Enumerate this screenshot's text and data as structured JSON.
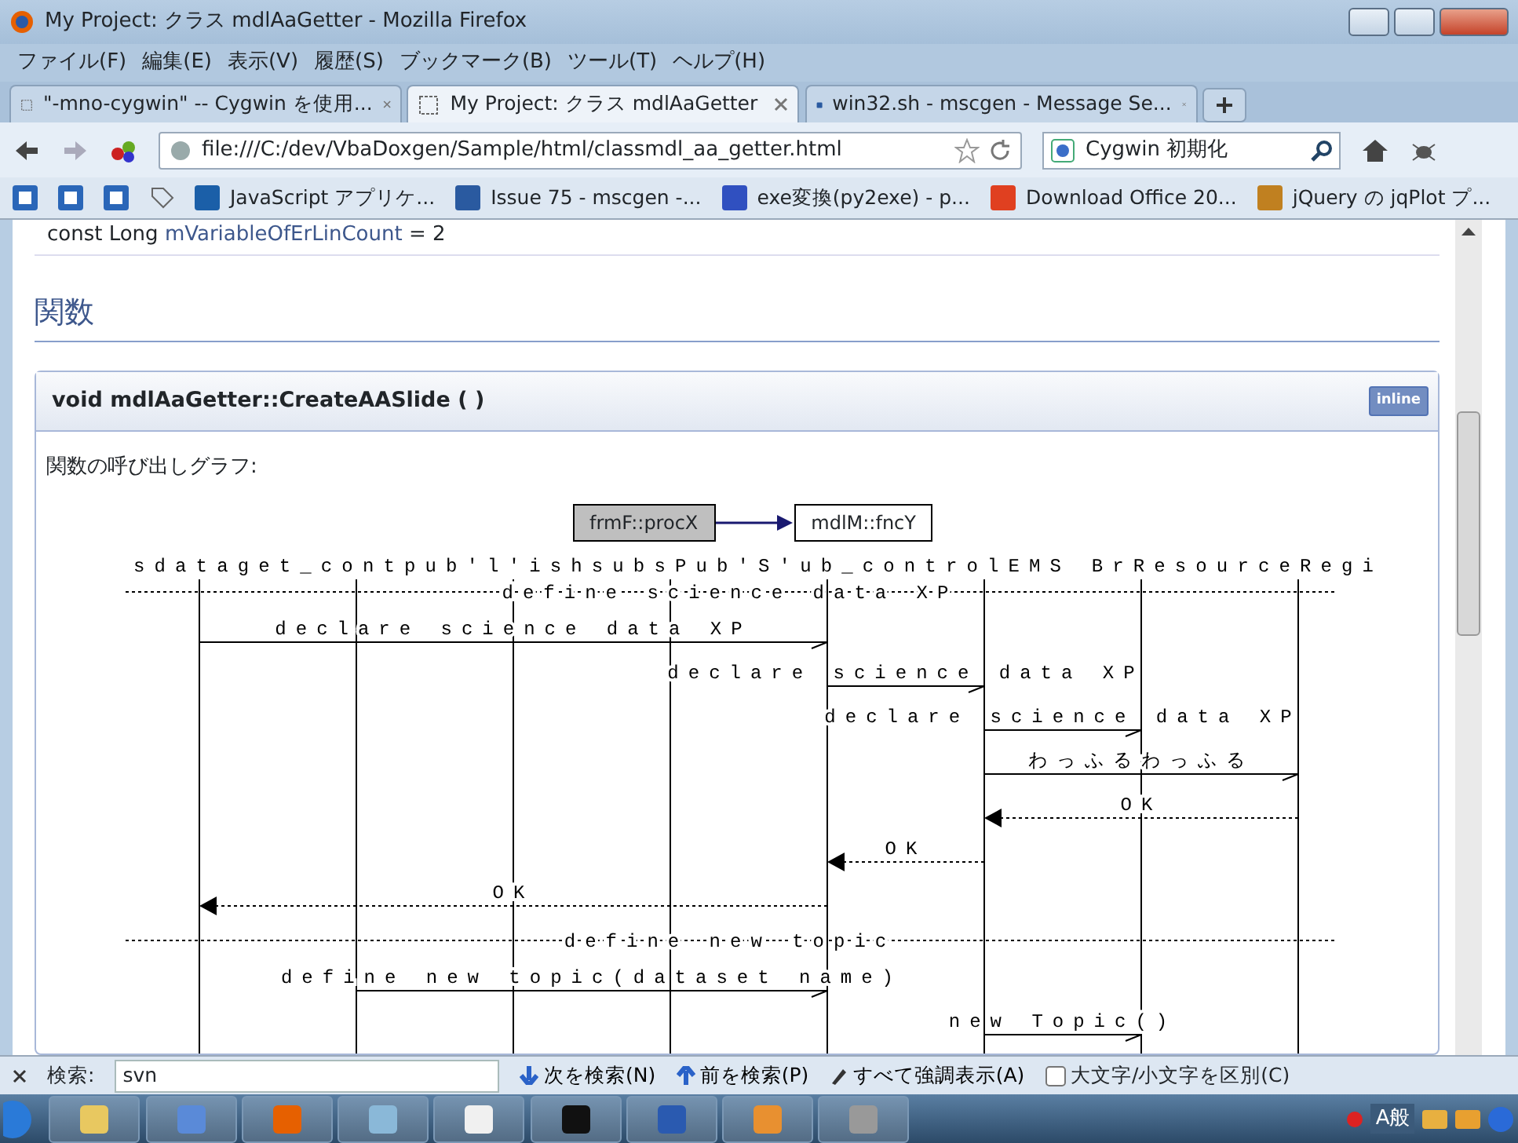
{
  "window": {
    "title": "My Project: クラス mdlAaGetter - Mozilla Firefox"
  },
  "menu": [
    "ファイル(F)",
    "編集(E)",
    "表示(V)",
    "履歴(S)",
    "ブックマーク(B)",
    "ツール(T)",
    "ヘルプ(H)"
  ],
  "tabs": [
    {
      "label": "\"-mno-cygwin\" -- Cygwin を使用...",
      "selected": false
    },
    {
      "label": "My Project: クラス mdlAaGetter",
      "selected": true
    },
    {
      "label": "win32.sh - mscgen - Message Se...",
      "selected": false
    }
  ],
  "address": {
    "url": "file:///C:/dev/VbaDoxgen/Sample/html/classmdl_aa_getter.html"
  },
  "search": {
    "value": "Cygwin 初期化"
  },
  "bookmarks": [
    {
      "label": "JavaScript アプリケ..."
    },
    {
      "label": "Issue 75 - mscgen -..."
    },
    {
      "label": "exe変換(py2exe) - p..."
    },
    {
      "label": "Download Office 20..."
    },
    {
      "label": "jQuery の jqPlot プ..."
    }
  ],
  "page": {
    "cut_line": {
      "prefix": "const Long",
      "link": "mVariableOfErLinCount",
      "suffix": "= 2"
    },
    "section_title": "関数",
    "member": {
      "signature": "void mdlAaGetter::CreateAASlide ( )",
      "badge": "inline",
      "graph_caption": "関数の呼び出しグラフ:",
      "call_graph": {
        "caller": "frmF::procX",
        "callee": "mdlM::fncY"
      },
      "sequence": {
        "header": "sdataget_contpub'l'ishsubsPub'S'ub_controlEMS   BrResourceRegi",
        "messages": [
          {
            "kind": "divider",
            "label": "define science data XP"
          },
          {
            "kind": "call",
            "label": "declare science data XP"
          },
          {
            "kind": "call",
            "label": "declare science data XP"
          },
          {
            "kind": "call",
            "label": "declare science data XP"
          },
          {
            "kind": "call",
            "label": "わっふるわっふる"
          },
          {
            "kind": "return",
            "label": "OK"
          },
          {
            "kind": "return",
            "label": "OK"
          },
          {
            "kind": "return",
            "label": "OK"
          },
          {
            "kind": "divider",
            "label": "define new topic"
          },
          {
            "kind": "call",
            "label": "define new topic(dataset name)"
          },
          {
            "kind": "call",
            "label": "new Topic()"
          }
        ]
      }
    }
  },
  "find_bar": {
    "label": "検索:",
    "value": "svn",
    "buttons": [
      "次を検索(N)",
      "前を検索(P)",
      "すべて強調表示(A)"
    ],
    "match_case": {
      "label": "大文字/小文字を区別(C)",
      "checked": false
    }
  },
  "tray": {
    "ime": "A般"
  }
}
